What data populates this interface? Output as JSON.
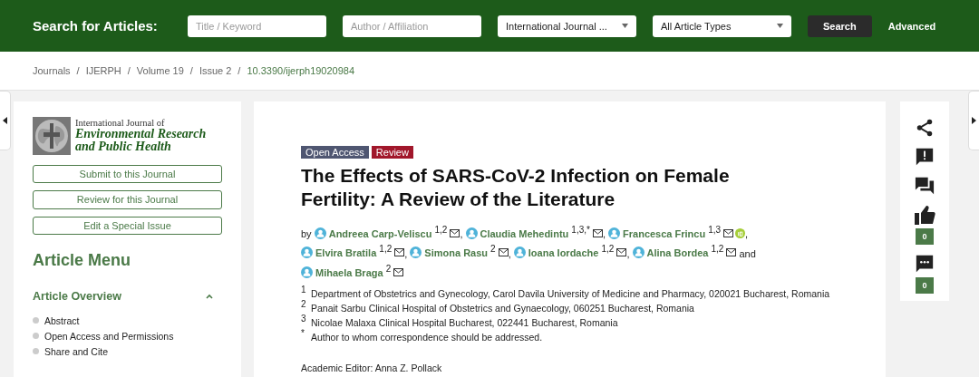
{
  "search_bar": {
    "label": "Search for Articles:",
    "fields": [
      {
        "placeholder": "Title / Keyword"
      },
      {
        "placeholder": "Author / Affiliation"
      }
    ],
    "selects": [
      {
        "value": "International Journal ..."
      },
      {
        "value": "All Article Types"
      }
    ],
    "search_button": "Search",
    "advanced_link": "Advanced"
  },
  "breadcrumb": [
    {
      "label": "Journals",
      "current": false
    },
    {
      "label": "IJERPH",
      "current": false
    },
    {
      "label": "Volume 19",
      "current": false
    },
    {
      "label": "Issue 2",
      "current": false
    },
    {
      "label": "10.3390/ijerph19020984",
      "current": true
    }
  ],
  "breadcrumb_separator": "/",
  "sidebar": {
    "journal_logo": {
      "line_1": "International Journal of",
      "line_2": "Environmental Research",
      "line_3": "and Public Health"
    },
    "buttons": [
      "Submit to this Journal",
      "Review for this Journal",
      "Edit a Special Issue"
    ],
    "menu_title": "Article Menu",
    "section": {
      "title": "Article Overview",
      "expanded": true,
      "items": [
        "Abstract",
        "Open Access and Permissions",
        "Share and Cite"
      ]
    }
  },
  "article": {
    "badges": [
      {
        "label": "Open Access",
        "color": "#4f5671"
      },
      {
        "label": "Review",
        "color": "#a1172b"
      }
    ],
    "title": "The Effects of SARS-CoV-2 Infection on Female Fertility: A Review of the Literature",
    "by": "by",
    "and": "and",
    "separator": ",",
    "authors": [
      {
        "name": "Andreea Carp-Veliscu",
        "affiliations": "1,2",
        "orcid": false
      },
      {
        "name": "Claudia Mehedintu",
        "affiliations": "1,3,*",
        "orcid": false
      },
      {
        "name": "Francesca Frincu",
        "affiliations": "1,3",
        "orcid": true
      },
      {
        "name": "Elvira Bratila",
        "affiliations": "1,2",
        "orcid": false
      },
      {
        "name": "Simona Rasu",
        "affiliations": "2",
        "orcid": false
      },
      {
        "name": "Ioana Iordache",
        "affiliations": "1,2",
        "orcid": false
      },
      {
        "name": "Alina Bordea",
        "affiliations": "1,2",
        "orcid": false
      },
      {
        "name": "Mihaela Braga",
        "affiliations": "2",
        "orcid": false
      }
    ],
    "affiliations": [
      {
        "mark": "1",
        "text": "Department of Obstetrics and Gynecology, Carol Davila University of Medicine and Pharmacy, 020021 Bucharest, Romania"
      },
      {
        "mark": "2",
        "text": "Panait Sarbu Clinical Hospital of Obstetrics and Gynaecology, 060251 Bucharest, Romania"
      },
      {
        "mark": "3",
        "text": "Nicolae Malaxa Clinical Hospital Bucharest, 022441 Bucharest, Romania"
      },
      {
        "mark": "*",
        "text": "Author to whom correspondence should be addressed."
      }
    ],
    "academic_editor": "Academic Editor: Anna Z. Pollack"
  },
  "right_toolbar": [
    {
      "kind": "share"
    },
    {
      "kind": "report"
    },
    {
      "kind": "discuss"
    },
    {
      "kind": "endorse",
      "count": "0"
    },
    {
      "kind": "comment",
      "count": "0"
    }
  ]
}
